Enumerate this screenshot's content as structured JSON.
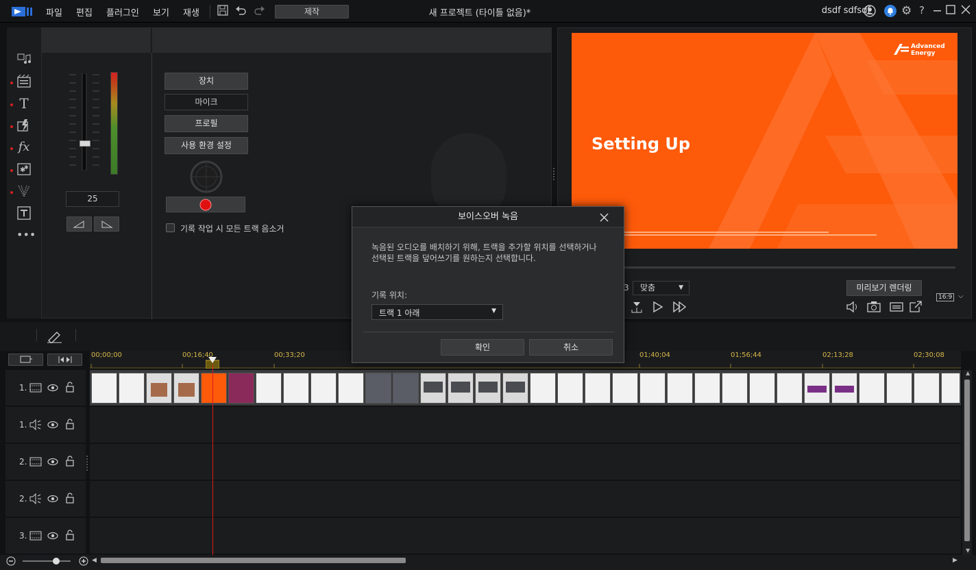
{
  "menu": {
    "file": "파일",
    "edit": "편집",
    "plugins": "플러그인",
    "view": "보기",
    "play": "재생",
    "produce": "제작"
  },
  "project_title": "새 프로젝트 (타이틀 없음)*",
  "user": {
    "name": "dsdf sdfsdf"
  },
  "voice": {
    "level_value": "25",
    "device_label": "장치",
    "mic_label": "마이크",
    "profile_label": "프로필",
    "prefs_label": "사용 환경 설정",
    "mute_all_label": "기록 작업 시 모든 트랙 음소거"
  },
  "preview": {
    "slide_title": "Setting Up",
    "brand_line1": "Advanced",
    "brand_line2": "Energy",
    "fit_label": "맞춤",
    "render_label": "미리보기 렌더링",
    "aspect_label": "16:9",
    "timecode_tail": "3"
  },
  "dialog": {
    "title": "보이스오버 녹음",
    "description": "녹음된 오디오를 배치하기 위해, 트랙을 추가할 위치를 선택하거나 선택된 트랙을 덮어쓰기를 원하는지 선택합니다.",
    "record_location_label": "기록 위치:",
    "record_location_value": "트랙 1 아래",
    "ok_label": "확인",
    "cancel_label": "취소"
  },
  "ruler": {
    "labels": [
      "00;00;00",
      "00;16;40",
      "00;33;20",
      "01;40;04",
      "01;56;44",
      "02;13;28",
      "02;30;08"
    ]
  },
  "tracks": [
    {
      "label": "1.",
      "type": "video"
    },
    {
      "label": "1.",
      "type": "audio"
    },
    {
      "label": "2.",
      "type": "video"
    },
    {
      "label": "2.",
      "type": "audio"
    },
    {
      "label": "3.",
      "type": "video"
    }
  ],
  "colors": {
    "accent": "#fd5a0a",
    "record": "#e01010",
    "bg": "#1b1c1e"
  }
}
